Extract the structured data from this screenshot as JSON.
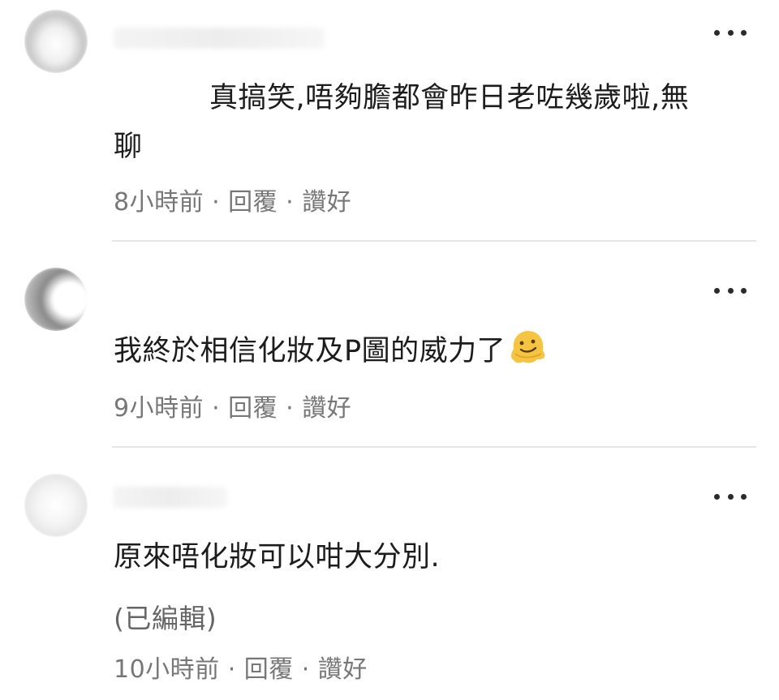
{
  "comments": [
    {
      "text_line1": "真搞笑,唔夠膽都會昨日老咗幾歲啦,無",
      "text_line2": "聊",
      "time": "8小時前",
      "reply": "回覆",
      "like": "讚好",
      "separator": "·"
    },
    {
      "text": "我終於相信化妝及P圖的威力了",
      "emoji": "melting-face-emoji",
      "time": "9小時前",
      "reply": "回覆",
      "like": "讚好",
      "separator": "·"
    },
    {
      "text": "原來唔化妝可以咁大分別.",
      "edited": "(已編輯)",
      "time": "10小時前",
      "reply": "回覆",
      "like": "讚好",
      "separator": "·"
    }
  ],
  "icons": {
    "more": "more-options-icon",
    "avatar": "avatar-blurred"
  },
  "colors": {
    "text": "#1c1c1c",
    "meta": "#777777",
    "divider": "#e6e6e6",
    "emoji": "#f5c542"
  }
}
